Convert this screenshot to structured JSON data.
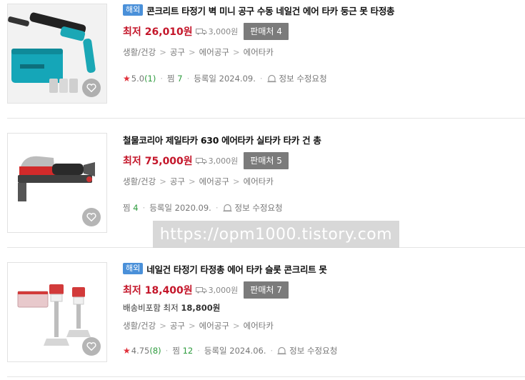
{
  "items": [
    {
      "badge": "해외",
      "title": "콘크리트 타정기 벽 미니 공구 수동 네일건 에어 타카 둥근 못 타정총",
      "price_label": "최저",
      "price": "26,010원",
      "shipping": "3,000원",
      "seller_btn": "판매처 4",
      "categories": [
        "생활/건강",
        "공구",
        "에어공구",
        "에어타카"
      ],
      "rating": "5.0",
      "reviews": "(1)",
      "wish_label": "찜",
      "wish_count": "7",
      "registered": "등록일 2024.09.",
      "report": "정보 수정요청"
    },
    {
      "badge": "",
      "title": "철물코리아 제일타카 630 에어타카 실타카 타카 건 총",
      "price_label": "최저",
      "price": "75,000원",
      "shipping": "3,000원",
      "seller_btn": "판매처 5",
      "categories": [
        "생활/건강",
        "공구",
        "에어공구",
        "에어타카"
      ],
      "wish_label": "찜",
      "wish_count": "4",
      "registered": "등록일 2020.09.",
      "report": "정보 수정요청"
    },
    {
      "badge": "해외",
      "title": "네일건 타정기 타정총 에어 타카 슬롯 콘크리트 못",
      "price_label": "최저",
      "price": "18,400원",
      "shipping": "3,000원",
      "seller_btn": "판매처 7",
      "combined_label": "배송비포함 최저",
      "combined_price": "18,800원",
      "categories": [
        "생활/건강",
        "공구",
        "에어공구",
        "에어타카"
      ],
      "rating": "4.75",
      "reviews": "(8)",
      "wish_label": "찜",
      "wish_count": "12",
      "registered": "등록일 2024.06.",
      "report": "정보 수정요청"
    }
  ],
  "watermark": "https://opm1000.tistory.com",
  "colors": {
    "price": "#c4162a",
    "badge": "#4a90d9",
    "seller_btn": "#7b7b7b",
    "star": "#e0303a",
    "count_green": "#2d9b3d"
  }
}
